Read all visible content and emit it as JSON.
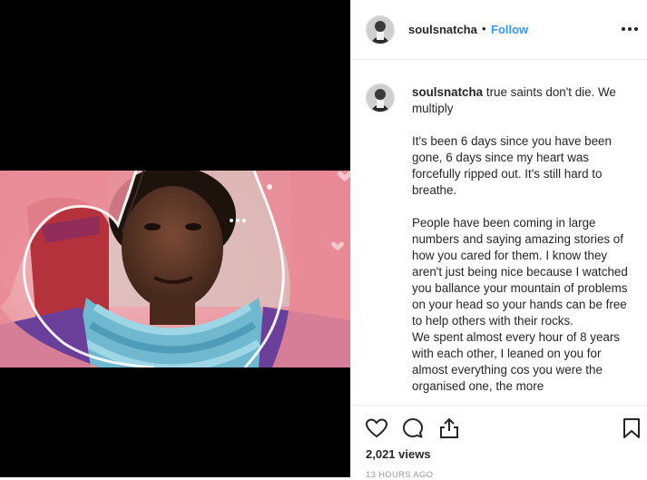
{
  "post": {
    "username": "soulsnatcha",
    "separator": "•",
    "follow_label": "Follow",
    "more_icon": "more-horizontal-icon"
  },
  "caption": {
    "username": "soulsnatcha",
    "line1": "true saints don't die. We multiply",
    "para1": "It's been 6 days since you have been gone, 6 days since my heart was forcefully ripped out. It's still hard to breathe.",
    "para2": "People have been coming in large numbers and saying amazing stories of how you cared for them. I know they aren't just being nice because I watched you ballance your mountain of problems on your head so your hands can be free to help others with their rocks.",
    "para3": "We spent almost every hour of 8 years with each other, I leaned on you for almost everything cos you were the organised one, the more"
  },
  "actions": {
    "like_icon": "heart-icon",
    "comment_icon": "comment-icon",
    "share_icon": "share-icon",
    "save_icon": "bookmark-icon",
    "views": "2,021 views",
    "timestamp": "13 HOURS AGO"
  },
  "colors": {
    "link": "#3897f0",
    "text": "#262626",
    "muted": "#999999",
    "border": "#efefef",
    "frame_pink": "#e98a97"
  }
}
